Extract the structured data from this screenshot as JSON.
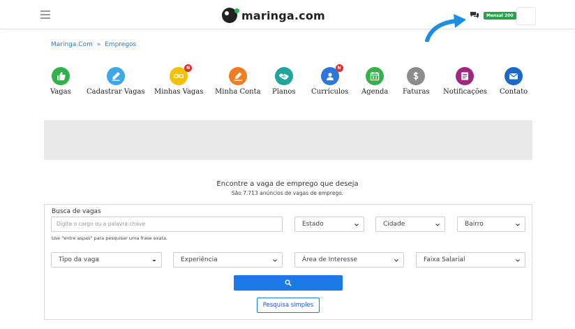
{
  "header": {
    "logo_text": "maringa.com",
    "plan_badge": "Mensal 200"
  },
  "breadcrumb": {
    "home": "Maringa.Com",
    "separator": "»",
    "current": "Empregos"
  },
  "menu": [
    {
      "label": "Vagas",
      "color": "#2fb14b",
      "icon": "thumbs-up-icon",
      "badge": ""
    },
    {
      "label": "Cadastrar Vagas",
      "color": "#3ea7e8",
      "icon": "pencil-icon",
      "badge": ""
    },
    {
      "label": "Minhas Vagas",
      "color": "#f2c200",
      "icon": "glasses-icon",
      "badge": "N"
    },
    {
      "label": "Minha Conta",
      "color": "#f07d22",
      "icon": "edit-icon",
      "badge": ""
    },
    {
      "label": "Planos",
      "color": "#1fa59a",
      "icon": "handshake-icon",
      "badge": ""
    },
    {
      "label": "Currículos",
      "color": "#2d77d9",
      "icon": "user-id-icon",
      "badge": "N"
    },
    {
      "label": "Agenda",
      "color": "#36b24a",
      "icon": "calendar-icon",
      "badge": ""
    },
    {
      "label": "Faturas",
      "color": "#8c8c8c",
      "icon": "dollar-icon",
      "badge": ""
    },
    {
      "label": "Notificações",
      "color": "#a0287f",
      "icon": "list-icon",
      "badge": ""
    },
    {
      "label": "Contato",
      "color": "#1a69c6",
      "icon": "envelope-icon",
      "badge": ""
    }
  ],
  "intro": {
    "headline": "Encontre a vaga de emprego que deseja",
    "subline": "São 7.713 anúncios de vagas de emprego."
  },
  "search": {
    "title": "Busca de vagas",
    "keyword_placeholder": "Digite o cargo ou a palavra-chave",
    "hint": "Use \"entre aspas\" para pesquisar uma frase exata.",
    "estado": "Estado",
    "cidade": "Cidade",
    "bairro": "Bairro",
    "tipo_vaga": "Tipo da vaga",
    "experiencia": "Experiência",
    "area_interesse": "Área de Interesse",
    "faixa_salarial": "Faixa Salarial",
    "simple_search_label": "Pesquisa simples"
  },
  "colors": {
    "accent": "#1a7be6",
    "badge_green": "#2aa14a",
    "arrow_blue": "#1e8fe0"
  }
}
